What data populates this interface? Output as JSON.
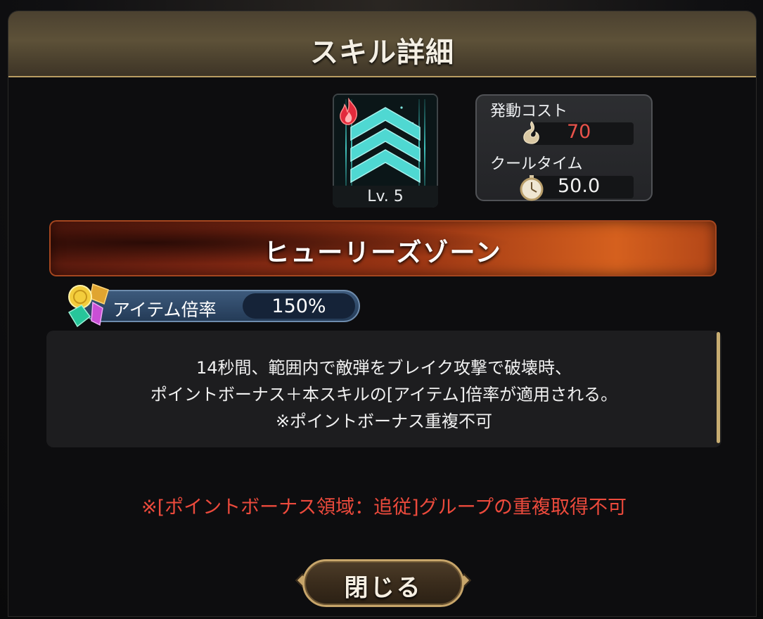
{
  "dialog": {
    "title": "スキル詳細"
  },
  "skill": {
    "level": "Lv. 5",
    "name": "ヒューリーズゾーン",
    "icon": "chevron-rank-up-icon",
    "element_icon": "fire-icon"
  },
  "stats": {
    "cost_label": "発動コスト",
    "cost_value": "70",
    "cost_icon": "soul-flame-icon",
    "cooltime_label": "クールタイム",
    "cooltime_value": "50.0",
    "cooltime_icon": "stopwatch-icon"
  },
  "item_rate": {
    "label": "アイテム倍率",
    "value": "150%",
    "icon": "gems-coin-icon"
  },
  "description": {
    "lines": [
      "14秒間、範囲内で敵弾をブレイク攻撃で破壊時、",
      "ポイントボーナス＋本スキルの[アイテム]倍率が適用される。",
      "※ポイントボーナス重複不可"
    ]
  },
  "warning": "※[ポイントボーナス領域：追従]グループの重複取得不可",
  "close_button": {
    "label": "閉じる"
  },
  "colors": {
    "header_gold": "#b89c62",
    "warning_red": "#ec4a3c",
    "cost_red": "#e8524a",
    "skill_teal": "#4fd8d2",
    "rate_blue": "#3d5a7c"
  }
}
